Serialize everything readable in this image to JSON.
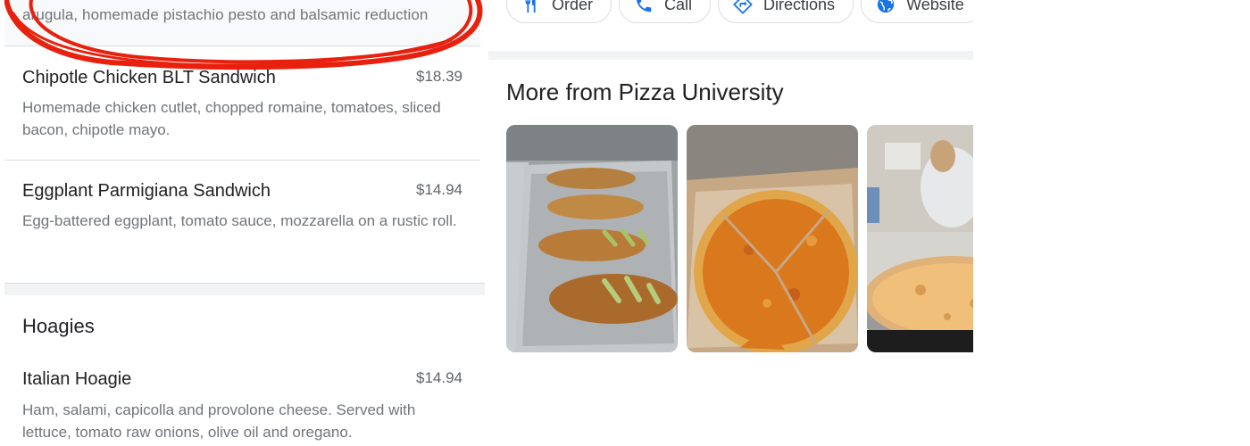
{
  "menu": {
    "top_item": {
      "desc": "arugula, homemade pistachio pesto and balsamic reduction"
    },
    "items": [
      {
        "name": "Chipotle Chicken BLT Sandwich",
        "price": "$18.39",
        "desc": "Homemade chicken cutlet, chopped romaine, tomatoes, sliced bacon, chipotle mayo."
      },
      {
        "name": "Eggplant Parmigiana Sandwich",
        "price": "$14.94",
        "desc": "Egg-battered eggplant, tomato sauce, mozzarella on a rustic roll."
      }
    ],
    "section": {
      "title": "Hoagies",
      "items": [
        {
          "name": "Italian Hoagie",
          "price": "$14.94",
          "desc": "Ham, salami, capicolla and provolone cheese. Served with lettuce, tomato raw onions, olive oil and oregano."
        }
      ]
    }
  },
  "actions": [
    {
      "label": "Order",
      "icon": "fork-knife-icon"
    },
    {
      "label": "Call",
      "icon": "phone-icon"
    },
    {
      "label": "Directions",
      "icon": "directions-icon"
    },
    {
      "label": "Website",
      "icon": "globe-icon"
    }
  ],
  "more": {
    "title": "More from Pizza University",
    "photos": [
      {
        "subject": "stromboli-tray"
      },
      {
        "subject": "pizza-box"
      },
      {
        "subject": "pizza-diner"
      }
    ]
  },
  "colors": {
    "accent": "#1a73e8",
    "scribble": "#e8210f",
    "divider": "#dadce0"
  }
}
